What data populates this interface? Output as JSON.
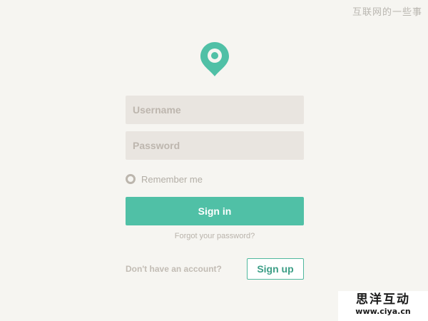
{
  "watermark": {
    "text": "互联网的一些事"
  },
  "logo": {
    "icon": "location-pin-icon",
    "color": "#50c0a6"
  },
  "form": {
    "username_placeholder": "Username",
    "password_placeholder": "Password",
    "remember_label": "Remember me",
    "remember_checked": false,
    "signin_label": "Sign in",
    "forgot_label": "Forgot your password?",
    "no_account_text": "Don't have an account?",
    "signup_label": "Sign up"
  },
  "brand": {
    "name": "思洋互动",
    "url": "www.ciya.cn"
  },
  "colors": {
    "background": "#f6f5f1",
    "accent": "#50c0a6",
    "field_bg": "#e9e5e0"
  }
}
